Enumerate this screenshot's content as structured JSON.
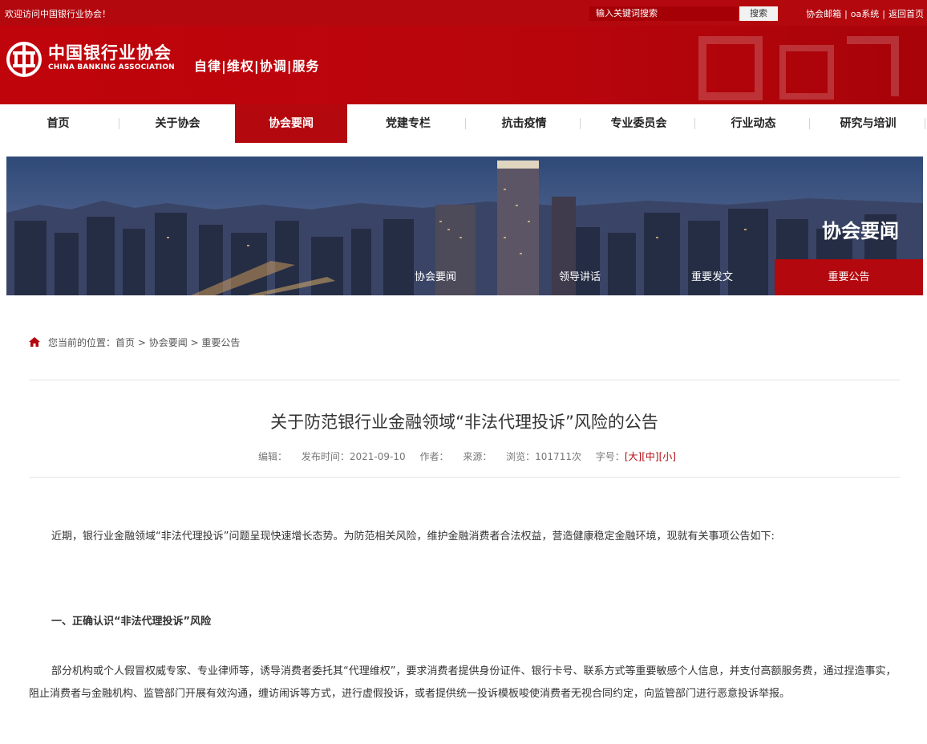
{
  "topbar": {
    "welcome": "欢迎访问中国银行业协会！",
    "search_placeholder": "输入关键词搜索",
    "search_button": "搜索",
    "links": [
      "协会邮箱",
      "oa系统",
      "返回首页"
    ]
  },
  "header": {
    "logo_cn": "中国银行业协会",
    "logo_en": "CHINA BANKING ASSOCIATION",
    "slogan": "自律|维权|协调|服务"
  },
  "nav": {
    "items": [
      "首页",
      "关于协会",
      "协会要闻",
      "党建专栏",
      "抗击疫情",
      "专业委员会",
      "行业动态",
      "研究与培训"
    ],
    "active": "协会要闻"
  },
  "banner": {
    "title": "协会要闻",
    "tabs": [
      "协会要闻",
      "领导讲话",
      "重要发文",
      "重要公告"
    ],
    "active_tab": "重要公告"
  },
  "breadcrumb": {
    "label": "您当前的位置：",
    "path": "首页 > 协会要闻 > 重要公告"
  },
  "article": {
    "title": "关于防范银行业金融领域“非法代理投诉”风险的公告",
    "meta": {
      "editor": "编辑：",
      "published": "发布时间：2021-09-10",
      "author": "作者：",
      "source": "来源：",
      "views": "浏览：101711次",
      "font_size_label": "字号：",
      "font_sizes": [
        "[大]",
        "[中]",
        "[小]"
      ]
    },
    "intro": "近期，银行业金融领域“非法代理投诉”问题呈现快速增长态势。为防范相关风险，维护金融消费者合法权益，营造健康稳定金融环境，现就有关事项公告如下:",
    "section1_heading": "一、正确认识“非法代理投诉”风险",
    "section1_text": "部分机构或个人假冒权威专家、专业律师等，诱导消费者委托其“代理维权”，要求消费者提供身份证件、银行卡号、联系方式等重要敏感个人信息，并支付高额服务费，通过捏造事实，阻止消费者与金融机构、监管部门开展有效沟通，缠访闹诉等方式，进行虚假投诉，或者提供统一投诉模板唆使消费者无视合同约定，向监管部门进行恶意投诉举报。"
  },
  "colors": {
    "brand_red": "#b3080e",
    "text": "#333333"
  }
}
